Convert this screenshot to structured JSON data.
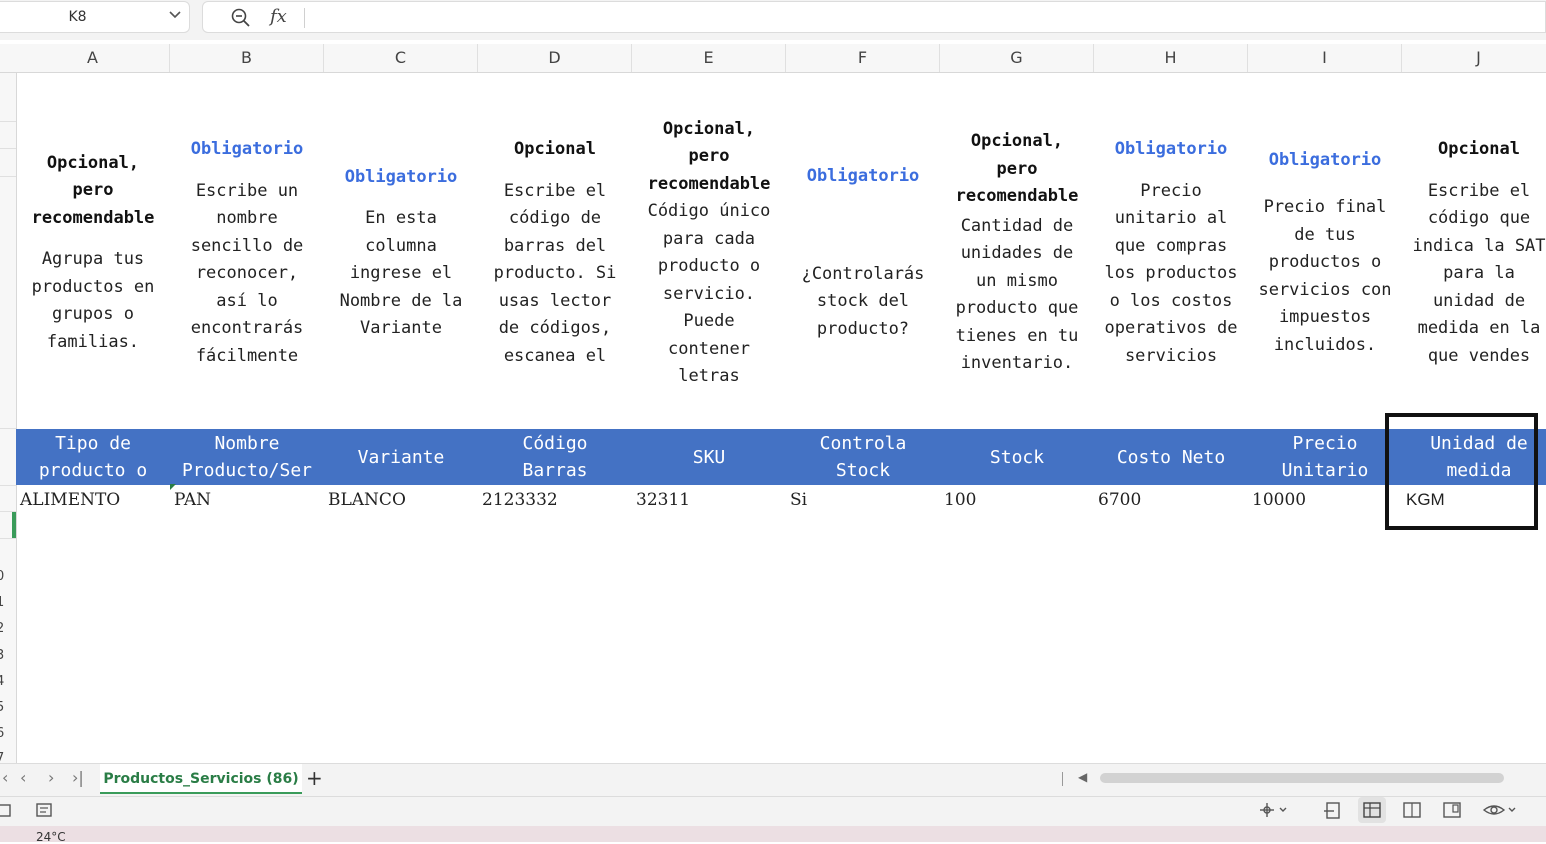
{
  "formula_bar": {
    "cell_ref": "K8",
    "formula_value": ""
  },
  "columns": [
    "A",
    "B",
    "C",
    "D",
    "E",
    "F",
    "G",
    "H",
    "I",
    "J"
  ],
  "rows_visible": [
    "0",
    "1",
    "2",
    "3",
    "4",
    "5",
    "6",
    "7"
  ],
  "descriptions": [
    {
      "tag": "Opcional,\npero\nrecomendable",
      "tag_color": "black",
      "text": "Agrupa tus\nproductos en\ngrupos o\nfamilias."
    },
    {
      "tag": "Obligatorio",
      "tag_color": "blue",
      "text": "Escribe un\nnombre\nsencillo de\nreconocer,\nasí lo\nencontrarás\nfácilmente"
    },
    {
      "tag": "Obligatorio",
      "tag_color": "blue",
      "text": "En esta\ncolumna\ningrese el\nNombre de la\nVariante"
    },
    {
      "tag": "Opcional",
      "tag_color": "black",
      "text": "Escribe el\ncódigo de\nbarras del\nproducto. Si\nusas lector\nde códigos,\nescanea el"
    },
    {
      "tag": "Opcional,\npero\nrecomendable",
      "tag_color": "black",
      "text": "Código único\npara cada\nproducto o\nservicio.\nPuede\ncontener\nletras"
    },
    {
      "tag": "Obligatorio",
      "tag_color": "blue",
      "text": "¿Controlarás\nstock del\nproducto?"
    },
    {
      "tag": "Opcional,\npero\nrecomendable",
      "tag_color": "black",
      "text": "Cantidad de\nunidades de\nun mismo\nproducto que\ntienes en tu\ninventario."
    },
    {
      "tag": "Obligatorio",
      "tag_color": "blue",
      "text": "Precio\nunitario al\nque compras\nlos productos\no los costos\noperativos de\nservicios"
    },
    {
      "tag": "Obligatorio",
      "tag_color": "blue",
      "text": "Precio final\nde tus\nproductos o\nservicios con\nimpuestos\nincluidos."
    },
    {
      "tag": "Opcional",
      "tag_color": "black",
      "text": "Escribe el\ncódigo que\nindica la SAT\npara la\nunidad de\nmedida en la\nque vendes"
    }
  ],
  "headers": [
    "Tipo de\nproducto o",
    "Nombre\nProducto/Ser",
    "Variante",
    "Código\nBarras",
    "SKU",
    "Controla\nStock",
    "Stock",
    "Costo Neto",
    "Precio\nUnitario",
    "Unidad de\nmedida"
  ],
  "data_row": [
    "ALIMENTO",
    "PAN",
    "BLANCO",
    "2123332",
    "32311",
    "Si",
    "100",
    "6700",
    "10000",
    "KGM"
  ],
  "sheet_tab": {
    "label": "Productos_Servicios (86)"
  },
  "taskbar": {
    "weather": "24°C"
  },
  "colors": {
    "header_band": "#4472c4",
    "required_tag": "#3b6dde",
    "active_tab": "#2a7d46"
  }
}
